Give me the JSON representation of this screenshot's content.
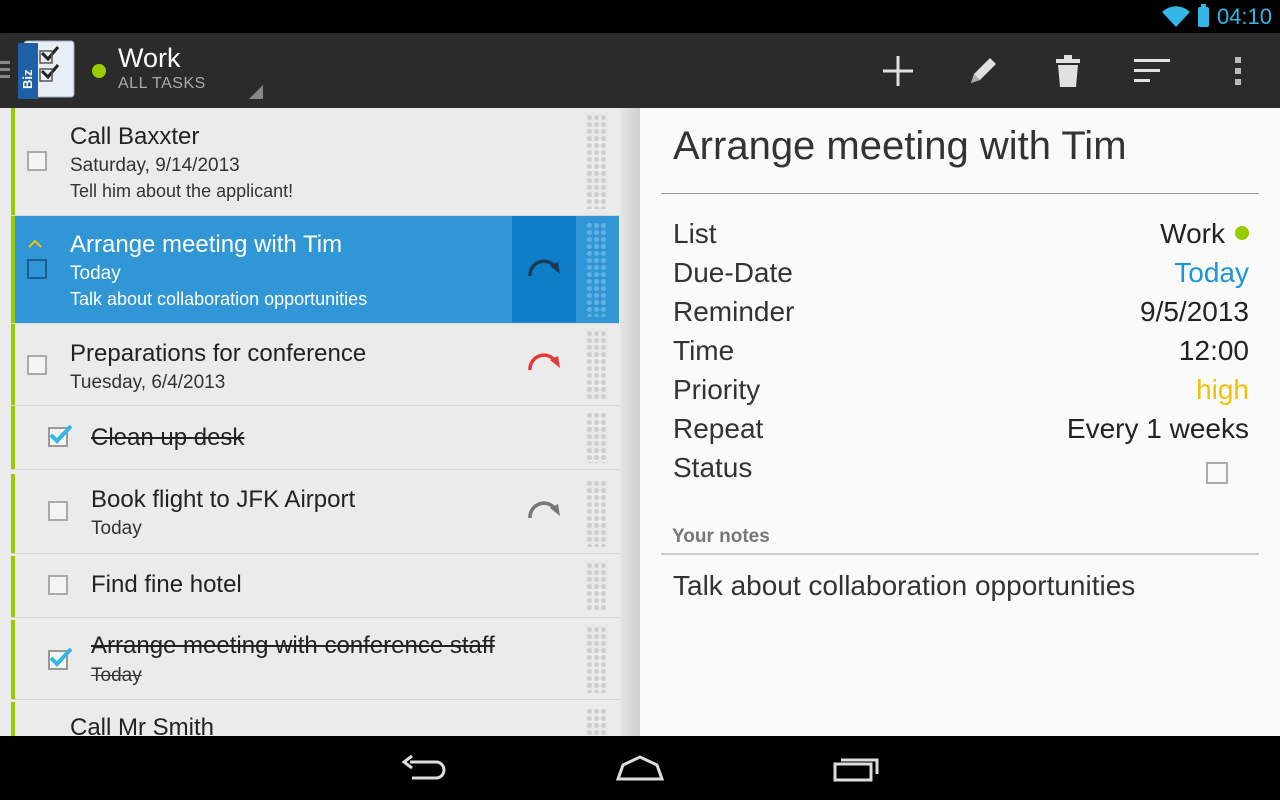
{
  "status_bar": {
    "time": "04:10"
  },
  "action_bar": {
    "app_logo_text": "Biz",
    "list_title": "Work",
    "list_subtitle": "ALL TASKS",
    "list_color": "#99cc00"
  },
  "tasks": [
    {
      "title": "Call Baxxter",
      "date": "Saturday, 9/14/2013",
      "note": "Tell him about the applicant!",
      "checked": false
    },
    {
      "title": "Arrange meeting with Tim",
      "date": "Today",
      "note": "Talk about collaboration opportunities",
      "checked": false,
      "selected": true
    },
    {
      "title": "Preparations for conference",
      "date": "Tuesday, 6/4/2013",
      "checked": false
    },
    {
      "title": "Clean up desk",
      "checked": true
    },
    {
      "title": "Book flight to JFK Airport",
      "date": "Today",
      "checked": false
    },
    {
      "title": "Find fine hotel",
      "checked": false
    },
    {
      "title": "Arrange meeting with conference staff",
      "date": "Today",
      "checked": true
    },
    {
      "title": "Call Mr Smith"
    }
  ],
  "detail": {
    "title": "Arrange meeting with Tim",
    "props": [
      {
        "key": "List",
        "value": "Work"
      },
      {
        "key": "Due-Date",
        "value": "Today"
      },
      {
        "key": "Reminder",
        "value": "9/5/2013"
      },
      {
        "key": "Time",
        "value": "12:00"
      },
      {
        "key": "Priority",
        "value": "high"
      },
      {
        "key": "Repeat",
        "value": "Every 1 weeks"
      },
      {
        "key": "Status",
        "value": ""
      }
    ],
    "notes_label": "Your notes",
    "notes": "Talk about collaboration opportunities"
  },
  "colors": {
    "accent_blue": "#33b5e5",
    "selected_row": "#3096d6",
    "priority_high": "#f5c000",
    "list_green": "#99cc00",
    "overdue_red": "#e53935"
  }
}
